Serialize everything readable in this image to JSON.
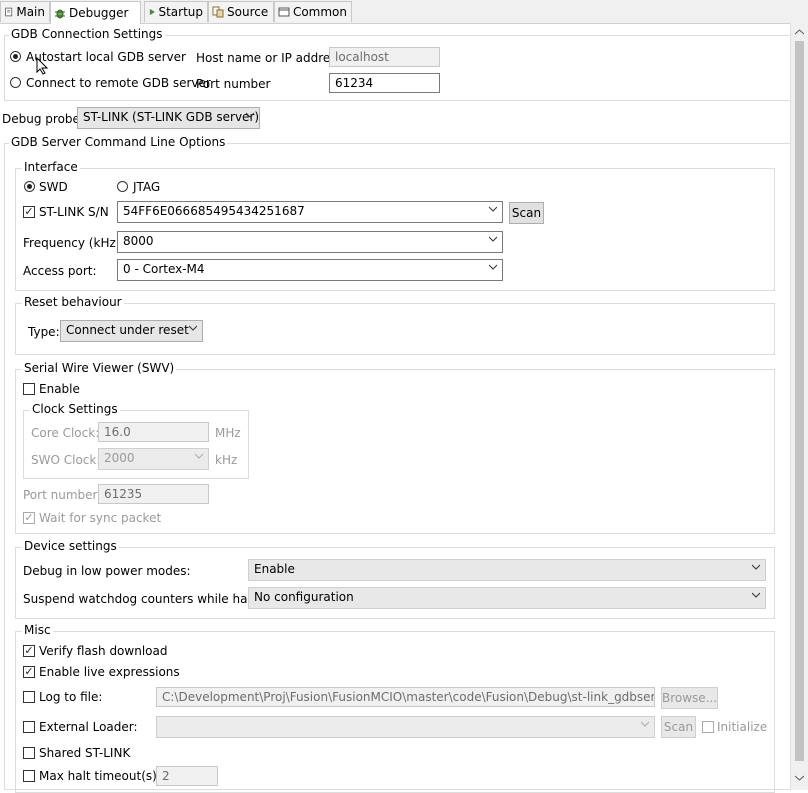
{
  "tabs": [
    {
      "label": "Main",
      "icon": "main-icon",
      "active": false
    },
    {
      "label": "Debugger",
      "icon": "debugger-bug-icon",
      "active": true
    },
    {
      "label": "Startup",
      "icon": "startup-play-icon",
      "active": false
    },
    {
      "label": "Source",
      "icon": "source-icon",
      "active": false
    },
    {
      "label": "Common",
      "icon": "common-icon",
      "active": false
    }
  ],
  "gdb_connection": {
    "title": "GDB Connection Settings",
    "autostart_label": "Autostart local GDB server",
    "remote_label": "Connect to remote GDB server",
    "host_label": "Host name or IP address",
    "host_value": "localhost",
    "port_label": "Port number",
    "port_value": "61234"
  },
  "debug_probe": {
    "label": "Debug probe",
    "value": "ST-LINK (ST-LINK GDB server)"
  },
  "server_options": {
    "title": "GDB Server Command Line Options"
  },
  "interface": {
    "title": "Interface",
    "swd_label": "SWD",
    "jtag_label": "JTAG",
    "stlink_sn_label": "ST-LINK S/N",
    "stlink_sn_value": "54FF6E066685495434251687",
    "scan_label": "Scan",
    "frequency_label": "Frequency (kHz):",
    "frequency_value": "8000",
    "access_port_label": "Access port:",
    "access_port_value": "0 - Cortex-M4"
  },
  "reset": {
    "title": "Reset behaviour",
    "type_label": "Type:",
    "type_value": "Connect under reset"
  },
  "swv": {
    "title": "Serial Wire Viewer (SWV)",
    "enable_label": "Enable",
    "clock_title": "Clock Settings",
    "core_clock_label": "Core Clock:",
    "core_clock_value": "16.0",
    "core_clock_unit": "MHz",
    "swo_clock_label": "SWO Clock:",
    "swo_clock_value": "2000",
    "swo_clock_unit": "kHz",
    "port_label": "Port number:",
    "port_value": "61235",
    "wait_sync_label": "Wait for sync packet"
  },
  "device": {
    "title": "Device settings",
    "low_power_label": "Debug in low power modes:",
    "low_power_value": "Enable",
    "watchdog_label": "Suspend watchdog counters while halted:",
    "watchdog_value": "No configuration"
  },
  "misc": {
    "title": "Misc",
    "verify_flash_label": "Verify flash download",
    "live_expr_label": "Enable live expressions",
    "log_file_label": "Log to file:",
    "log_file_value": "C:\\Development\\Proj\\Fusion\\FusionMCIO\\master\\code\\Fusion\\Debug\\st-link_gdbserver_log",
    "browse_label": "Browse...",
    "ext_loader_label": "External Loader:",
    "ext_loader_value": "",
    "scan_label": "Scan",
    "initialize_label": "Initialize",
    "shared_label": "Shared ST-LINK",
    "max_halt_label": "Max halt timeout(s):",
    "max_halt_value": "2"
  }
}
